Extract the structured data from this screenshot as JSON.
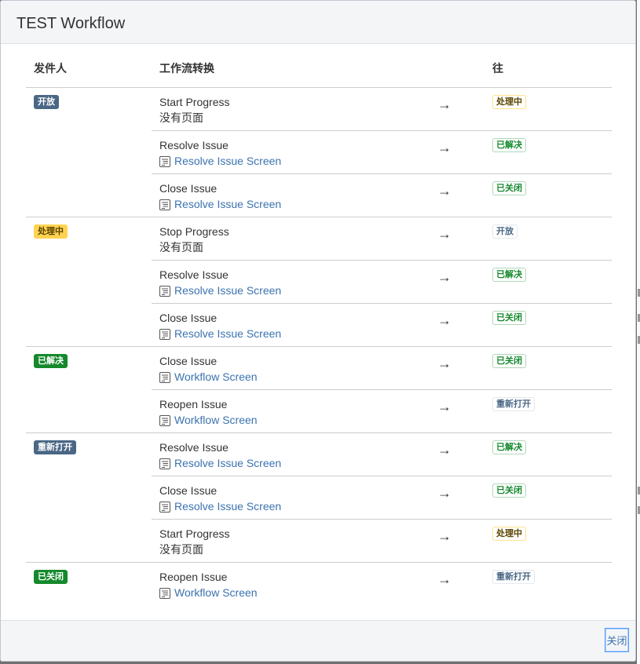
{
  "dialog": {
    "title": "TEST Workflow",
    "close_label": "关闭"
  },
  "table": {
    "headers": {
      "from": "发件人",
      "transition": "工作流转换",
      "to": "往"
    },
    "arrow": "→",
    "no_screen": "没有页面",
    "groups": [
      {
        "from": {
          "label": "开放",
          "style": "blue"
        },
        "rows": [
          {
            "transition": "Start Progress",
            "screen": "没有页面",
            "screen_link": false,
            "to": {
              "label": "处理中",
              "style": "yellow"
            }
          },
          {
            "transition": "Resolve Issue",
            "screen": "Resolve Issue Screen",
            "screen_link": true,
            "to": {
              "label": "已解决",
              "style": "green"
            }
          },
          {
            "transition": "Close Issue",
            "screen": "Resolve Issue Screen",
            "screen_link": true,
            "to": {
              "label": "已关闭",
              "style": "green"
            }
          }
        ]
      },
      {
        "from": {
          "label": "处理中",
          "style": "yellow"
        },
        "rows": [
          {
            "transition": "Stop Progress",
            "screen": "没有页面",
            "screen_link": false,
            "to": {
              "label": "开放",
              "style": "blue"
            }
          },
          {
            "transition": "Resolve Issue",
            "screen": "Resolve Issue Screen",
            "screen_link": true,
            "to": {
              "label": "已解决",
              "style": "green"
            }
          },
          {
            "transition": "Close Issue",
            "screen": "Resolve Issue Screen",
            "screen_link": true,
            "to": {
              "label": "已关闭",
              "style": "green"
            }
          }
        ]
      },
      {
        "from": {
          "label": "已解决",
          "style": "green"
        },
        "rows": [
          {
            "transition": "Close Issue",
            "screen": "Workflow Screen",
            "screen_link": true,
            "to": {
              "label": "已关闭",
              "style": "green"
            }
          },
          {
            "transition": "Reopen Issue",
            "screen": "Workflow Screen",
            "screen_link": true,
            "to": {
              "label": "重新打开",
              "style": "blue"
            }
          }
        ]
      },
      {
        "from": {
          "label": "重新打开",
          "style": "blue"
        },
        "rows": [
          {
            "transition": "Resolve Issue",
            "screen": "Resolve Issue Screen",
            "screen_link": true,
            "to": {
              "label": "已解决",
              "style": "green"
            }
          },
          {
            "transition": "Close Issue",
            "screen": "Resolve Issue Screen",
            "screen_link": true,
            "to": {
              "label": "已关闭",
              "style": "green"
            }
          },
          {
            "transition": "Start Progress",
            "screen": "没有页面",
            "screen_link": false,
            "to": {
              "label": "处理中",
              "style": "yellow"
            }
          }
        ]
      },
      {
        "from": {
          "label": "已关闭",
          "style": "green"
        },
        "rows": [
          {
            "transition": "Reopen Issue",
            "screen": "Workflow Screen",
            "screen_link": true,
            "to": {
              "label": "重新打开",
              "style": "blue"
            }
          }
        ]
      }
    ]
  },
  "colors": {
    "blue_status": "#4a6785",
    "yellow_status": "#ffd351",
    "green_status": "#14892c",
    "link": "#3b73af"
  },
  "icons": {
    "screen": "screen-icon"
  }
}
